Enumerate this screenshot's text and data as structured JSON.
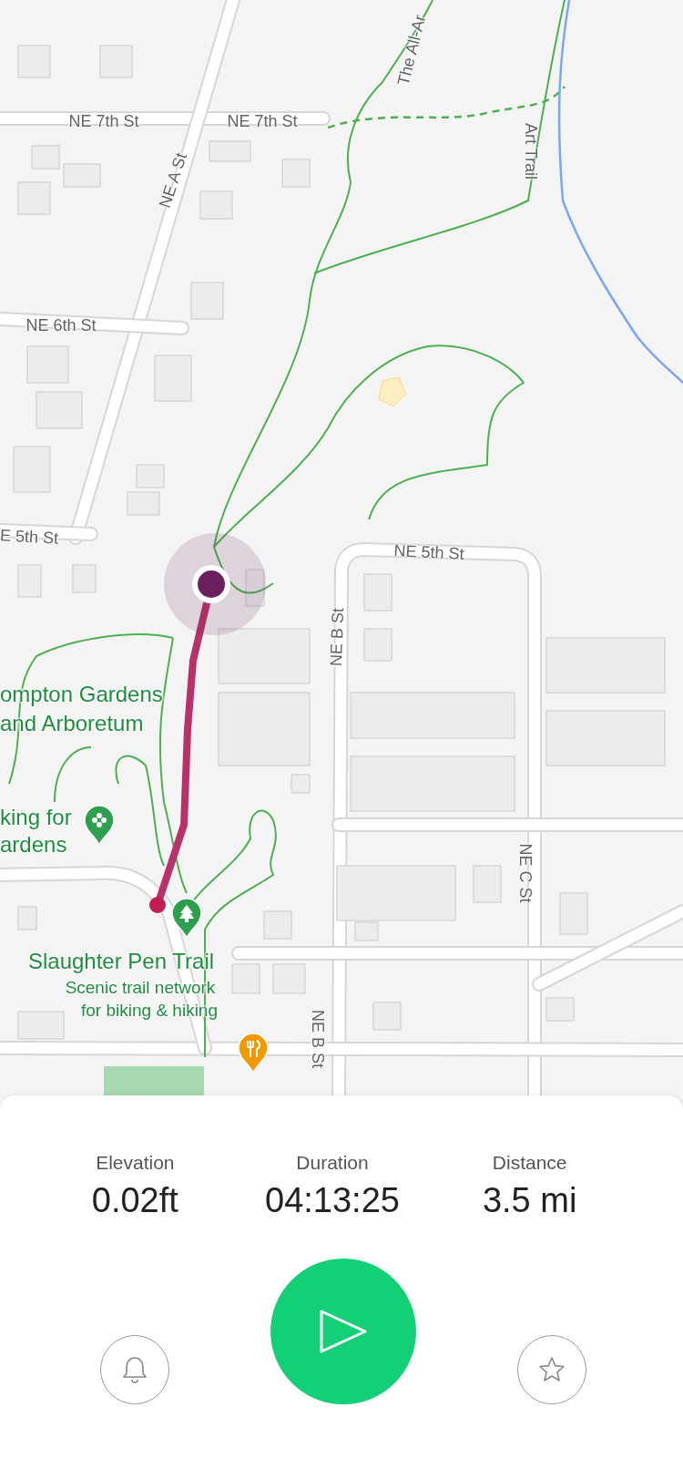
{
  "map": {
    "labels": [
      {
        "text": "NE 7th St",
        "kind": "street"
      },
      {
        "text": "NE 7th St",
        "kind": "street"
      },
      {
        "text": "NE A St",
        "kind": "street"
      },
      {
        "text": "The All-Ar",
        "kind": "street"
      },
      {
        "text": "Art Trail",
        "kind": "street"
      },
      {
        "text": "NE 6th St",
        "kind": "street"
      },
      {
        "text": "E 5th St",
        "kind": "street"
      },
      {
        "text": "NE 5th St",
        "kind": "street"
      },
      {
        "text": "NE B St",
        "kind": "street"
      },
      {
        "text": "ompton Gardens",
        "kind": "park"
      },
      {
        "text": "and Arboretum",
        "kind": "park"
      },
      {
        "text": "king for",
        "kind": "park"
      },
      {
        "text": "ardens",
        "kind": "park"
      },
      {
        "text": "NE C St",
        "kind": "street"
      },
      {
        "text": "Slaughter Pen Trail",
        "kind": "park"
      },
      {
        "text": "Scenic trail network",
        "kind": "note"
      },
      {
        "text": "for biking & hiking",
        "kind": "note"
      },
      {
        "text": "NE B St",
        "kind": "street"
      }
    ]
  },
  "stats": [
    {
      "label": "Elevation",
      "value": "0.02ft"
    },
    {
      "label": "Duration",
      "value": "04:13:25"
    },
    {
      "label": "Distance",
      "value": "3.5 mi"
    }
  ]
}
